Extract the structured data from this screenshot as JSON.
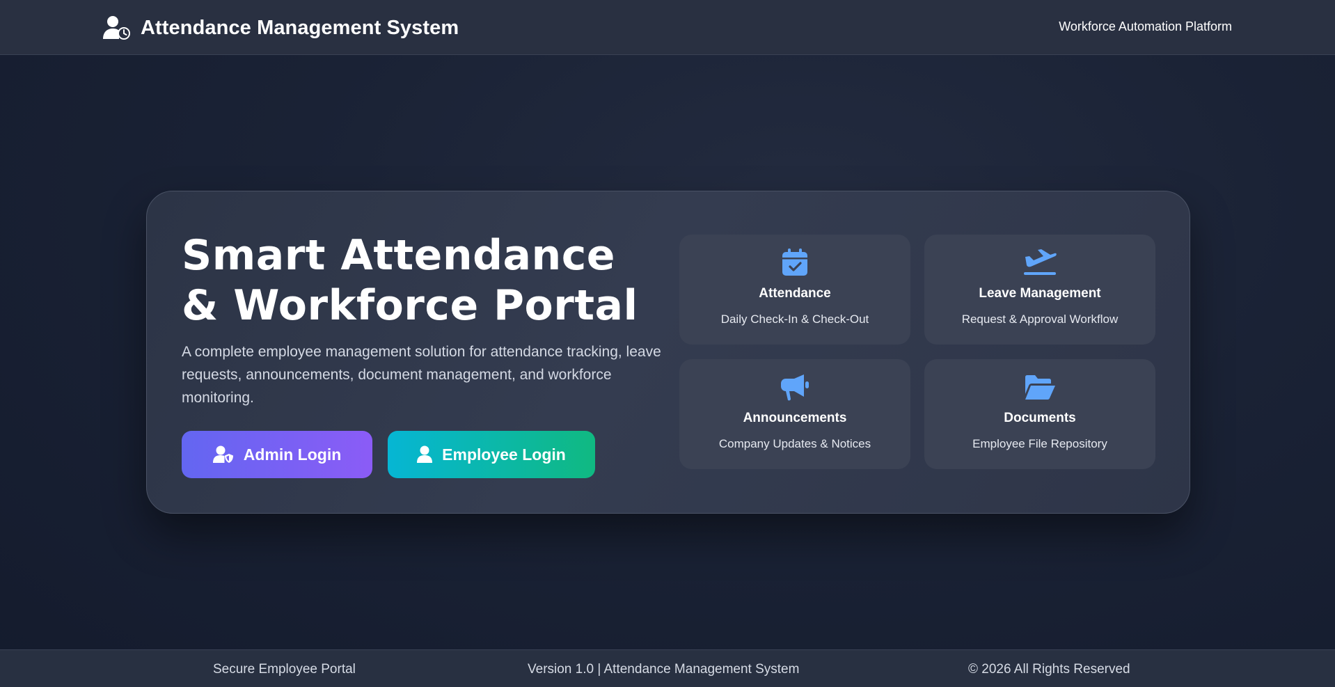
{
  "header": {
    "title": "Attendance Management System",
    "platform_label": "Workforce Automation Platform",
    "icon": "user-clock-icon"
  },
  "hero": {
    "title": "Smart Attendance & Workforce Portal",
    "description": "A complete employee management solution for attendance tracking, leave requests, announcements, document management, and workforce monitoring.",
    "admin_button": {
      "label": "Admin Login",
      "icon": "user-shield-icon"
    },
    "employee_button": {
      "label": "Employee Login",
      "icon": "user-icon"
    }
  },
  "features": [
    {
      "title": "Attendance",
      "subtitle": "Daily Check-In & Check-Out",
      "icon": "calendar-check-icon"
    },
    {
      "title": "Leave Management",
      "subtitle": "Request & Approval Workflow",
      "icon": "plane-departure-icon"
    },
    {
      "title": "Announcements",
      "subtitle": "Company Updates & Notices",
      "icon": "megaphone-icon"
    },
    {
      "title": "Documents",
      "subtitle": "Employee File Repository",
      "icon": "folder-open-icon"
    }
  ],
  "footer": {
    "left": "Secure Employee Portal",
    "center": "Version 1.0 | Attendance Management System",
    "right": "© 2026 All Rights Reserved"
  },
  "colors": {
    "accent_icon": "#60a5fa",
    "admin_gradient": [
      "#6366f1",
      "#8b5cf6"
    ],
    "employee_gradient": [
      "#06b6d4",
      "#10b981"
    ],
    "background": "#141b2d"
  }
}
